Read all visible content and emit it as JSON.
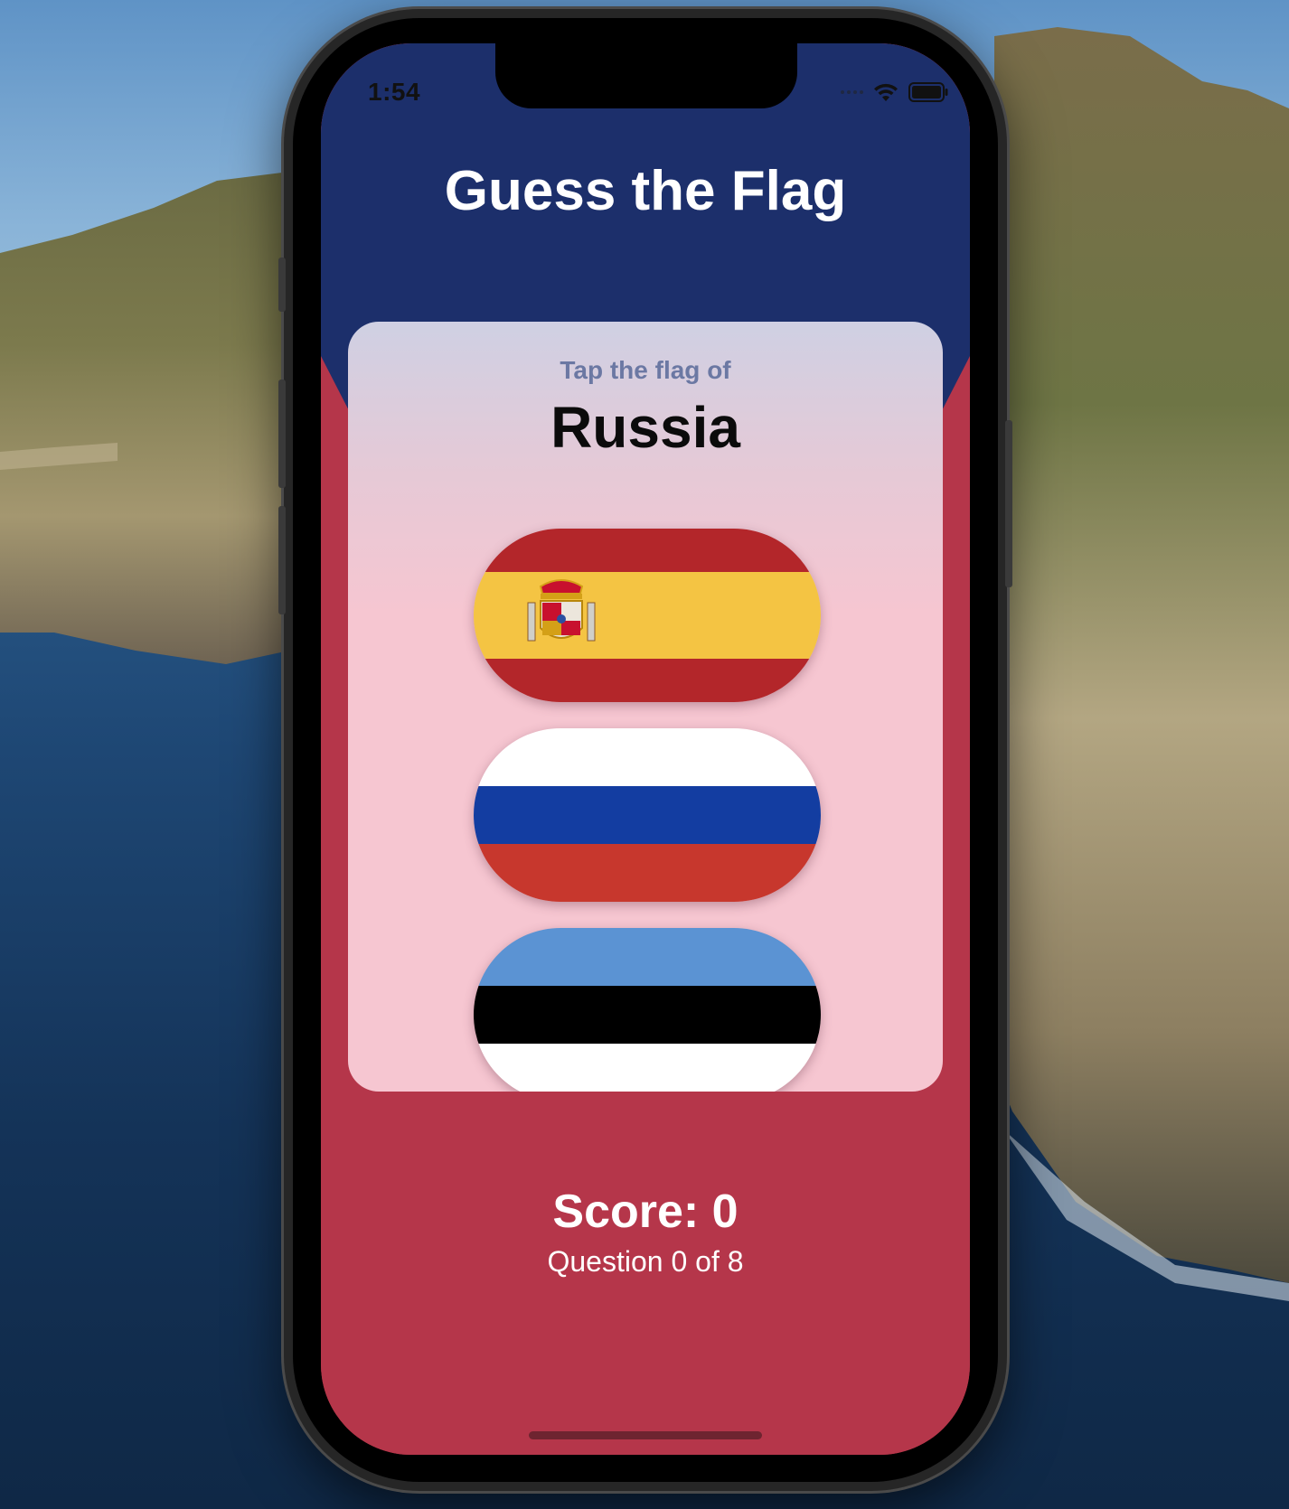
{
  "status_bar": {
    "time": "1:54",
    "icons": [
      "signal-icon",
      "wifi-icon",
      "battery-icon"
    ]
  },
  "app": {
    "title": "Guess the Flag",
    "prompt": "Tap the flag of",
    "country": "Russia",
    "options": [
      {
        "country": "Spain",
        "stripes": [
          "#b3262a",
          "#f4c443",
          "#b3262a"
        ]
      },
      {
        "country": "Russia",
        "stripes": [
          "#ffffff",
          "#133da1",
          "#c7372d"
        ]
      },
      {
        "country": "Estonia",
        "stripes": [
          "#5b93d3",
          "#000000",
          "#ffffff"
        ]
      }
    ],
    "score": "Score: 0",
    "question": "Question 0 of 8"
  },
  "colors": {
    "top_background": "#1c2f6b",
    "bottom_background": "#b5364a",
    "card": "#f6c6d1"
  }
}
